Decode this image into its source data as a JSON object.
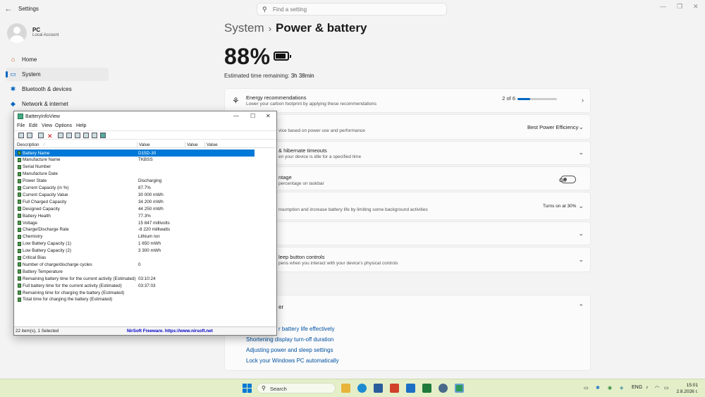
{
  "settings": {
    "app_title": "Settings",
    "search_placeholder": "Find a setting",
    "user": {
      "name": "PC",
      "type": "Local Account"
    },
    "nav": [
      {
        "label": "Home",
        "icon": "home-icon"
      },
      {
        "label": "System",
        "icon": "system-icon"
      },
      {
        "label": "Bluetooth & devices",
        "icon": "bluetooth-icon"
      },
      {
        "label": "Network & internet",
        "icon": "network-icon"
      }
    ],
    "breadcrumb": {
      "parent": "System",
      "separator": "›",
      "current": "Power & battery"
    },
    "battery_percent": "88%",
    "estimated": {
      "label": "Estimated time remaining:",
      "value": "3h 38min"
    },
    "cards": {
      "energy": {
        "title": "Energy recommendations",
        "subtitle": "Lower your carbon footprint by applying these recommendations",
        "progress_text": "2 of 6",
        "progress": 0.33
      },
      "power_mode": {
        "subtitle": "vice based on power use and performance",
        "value": "Best Power Efficiency"
      },
      "timeouts": {
        "title": "& hibernate timeouts",
        "subtitle": "en your device is idle for a specified time"
      },
      "percentage": {
        "title": "ntage",
        "subtitle": "percentage on taskbar",
        "value": "Off"
      },
      "saver": {
        "subtitle": "nsumption and increase battery life by limiting some background activities",
        "value": "Turns on at 30%"
      },
      "lid": {
        "title": "leep button controls",
        "subtitle": "pens when you interact with your device's physical controls"
      },
      "help": {
        "title": "er"
      }
    },
    "links": [
      "r battery life effectively",
      "Shortening display turn-off duration",
      "Adjusting power and sleep settings",
      "Lock your Windows PC automatically"
    ]
  },
  "biv": {
    "title": "BatteryInfoView",
    "menu": [
      "File",
      "Edit",
      "View",
      "Options",
      "Help"
    ],
    "columns": [
      "Description",
      "Value",
      "Value",
      "Value"
    ],
    "rows": [
      {
        "desc": "Battery Name",
        "value": "D15D-30"
      },
      {
        "desc": "Manufacture Name",
        "value": "TKBSS"
      },
      {
        "desc": "Serial Number",
        "value": ""
      },
      {
        "desc": "Manufacture Date",
        "value": ""
      },
      {
        "desc": "Power State",
        "value": "Discharging"
      },
      {
        "desc": "Current Capacity (in %)",
        "value": "87.7%"
      },
      {
        "desc": "Current Capacity Value",
        "value": "30 000 mWh"
      },
      {
        "desc": "Full Charged Capacity",
        "value": "34 200 mWh"
      },
      {
        "desc": "Designed Capacity",
        "value": "44 250 mWh"
      },
      {
        "desc": "Battery Health",
        "value": "77.3%"
      },
      {
        "desc": "Voltage",
        "value": "15 847 millivolts"
      },
      {
        "desc": "Charge/Discharge Rate",
        "value": "-8 220 milliwatts"
      },
      {
        "desc": "Chemistry",
        "value": "Lithium Ion"
      },
      {
        "desc": "Low Battery Capacity (1)",
        "value": "1 650 mWh"
      },
      {
        "desc": "Low Battery Capacity (2)",
        "value": "3 300 mWh"
      },
      {
        "desc": "Critical Bias",
        "value": ""
      },
      {
        "desc": "Number of charge/discharge cycles",
        "value": "0"
      },
      {
        "desc": "Battery Temperature",
        "value": ""
      },
      {
        "desc": "Remaining battery time for the current activity (Estimated)",
        "value": "03:10:24"
      },
      {
        "desc": "Full battery time for the current activity (Estimated)",
        "value": "03:37:03"
      },
      {
        "desc": "Remaining time for charging the battery (Estimated)",
        "value": ""
      },
      {
        "desc": "Total  time for charging the battery (Estimated)",
        "value": ""
      }
    ],
    "status_count": "22 item(s), 1 Selected",
    "status_link": "NirSoft Freeware. https://www.nirsoft.net"
  },
  "taskbar": {
    "search_label": "Search",
    "lang": "ENG",
    "time": "15:01",
    "date": "2.8.2026 г."
  },
  "colors": {
    "accent": "#0067c0",
    "selection": "#0078d7",
    "taskbar": "#e4efc9"
  }
}
